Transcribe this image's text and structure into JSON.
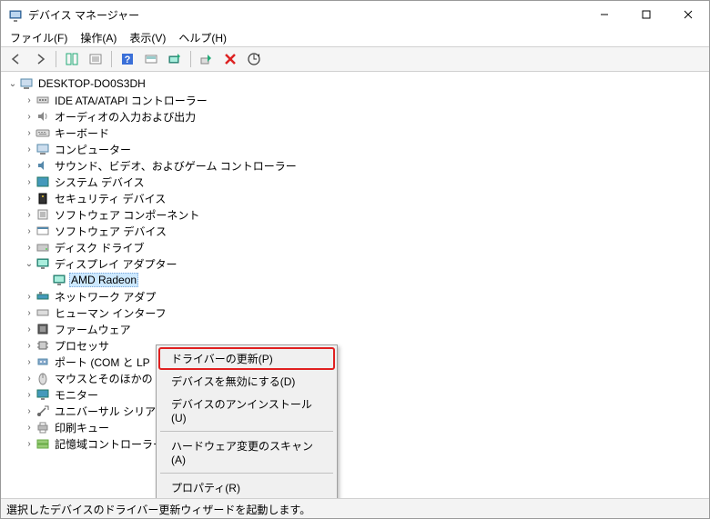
{
  "title": "デバイス マネージャー",
  "menu": {
    "file": "ファイル(F)",
    "action": "操作(A)",
    "view": "表示(V)",
    "help": "ヘルプ(H)"
  },
  "tree": {
    "root": "DESKTOP-DO0S3DH",
    "items": [
      "IDE ATA/ATAPI コントローラー",
      "オーディオの入力および出力",
      "キーボード",
      "コンピューター",
      "サウンド、ビデオ、およびゲーム コントローラー",
      "システム デバイス",
      "セキュリティ デバイス",
      "ソフトウェア コンポーネント",
      "ソフトウェア デバイス",
      "ディスク ドライブ",
      "ディスプレイ アダプター",
      "ネットワーク アダプ",
      "ヒューマン インターフ",
      "ファームウェア",
      "プロセッサ",
      "ポート (COM と LP",
      "マウスとそのほかの",
      "モニター",
      "ユニバーサル シリアル バス コントローラー",
      "印刷キュー",
      "記憶域コントローラー"
    ],
    "selected_child": "AMD Radeon"
  },
  "context_menu": {
    "update_driver": "ドライバーの更新(P)",
    "disable": "デバイスを無効にする(D)",
    "uninstall": "デバイスのアンインストール(U)",
    "scan": "ハードウェア変更のスキャン(A)",
    "properties": "プロパティ(R)"
  },
  "status": "選択したデバイスのドライバー更新ウィザードを起動します。"
}
